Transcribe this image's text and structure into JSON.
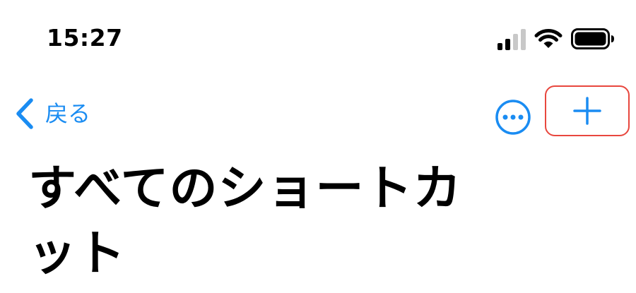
{
  "status_bar": {
    "time": "15:27",
    "icons": [
      "cellular-signal-icon",
      "wifi-icon",
      "battery-icon"
    ]
  },
  "nav_bar": {
    "back_label": "戻る",
    "icons": {
      "back": "chevron-left-icon",
      "more": "ellipsis-circle-icon",
      "add": "plus-icon"
    }
  },
  "page": {
    "title": "すべてのショートカット"
  },
  "colors": {
    "accent": "#1a8cf2",
    "highlight_border": "#e8473e",
    "text": "#000000",
    "background": "#ffffff"
  }
}
